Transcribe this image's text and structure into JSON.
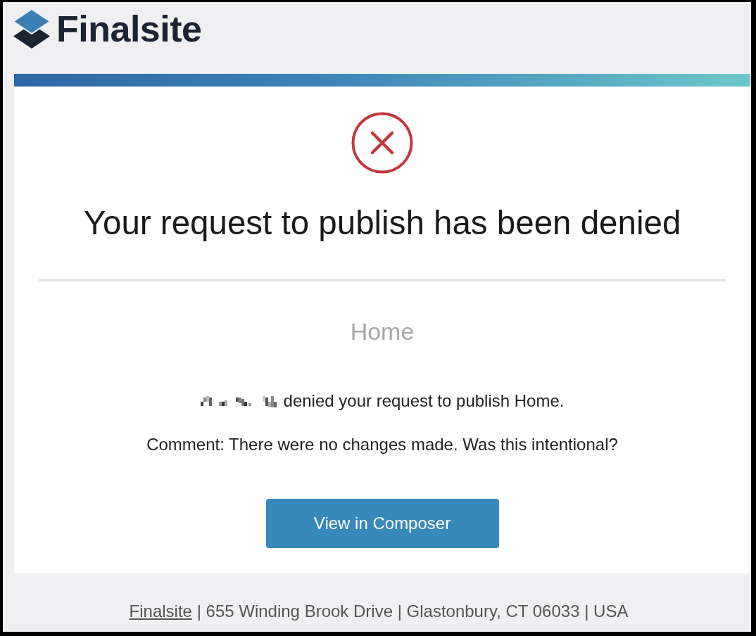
{
  "header": {
    "logo_text": "Finalsite"
  },
  "card": {
    "title": "Your request to publish has been denied",
    "page_name": "Home",
    "message": {
      "name_pixelated": true,
      "text": "denied your request to publish Home."
    },
    "comment": "Comment: There were no changes made. Was this intentional?",
    "button": "View in Composer"
  },
  "footer": {
    "link": "Finalsite",
    "text": " | 655 Winding Brook Drive | Glastonbury, CT 06033 | USA"
  }
}
